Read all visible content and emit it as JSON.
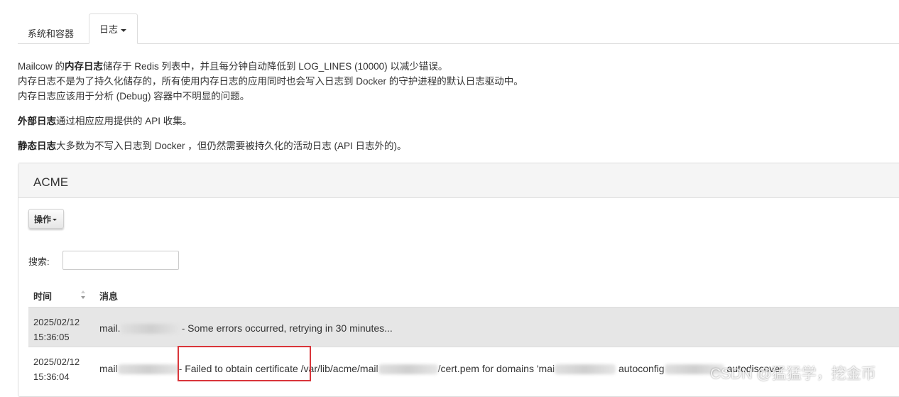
{
  "tabs": {
    "system": "系统和容器",
    "logs": "日志"
  },
  "intro": {
    "line1_pre": "Mailcow 的",
    "line1_bold": "内存日志",
    "line1_post": "储存于 Redis 列表中，并且每分钟自动降低到 LOG_LINES (10000) 以减少错误。",
    "line2": "内存日志不是为了持久化储存的，所有使用内存日志的应用同时也会写入日志到 Docker 的守护进程的默认日志驱动中。",
    "line3": "内存日志应该用于分析 (Debug) 容器中不明显的问题。",
    "line4_bold": "外部日志",
    "line4_post": "通过相应应用提供的 API 收集。",
    "line5_bold": "静态日志",
    "line5_post": "大多数为不写入日志到 Docker ，但仍然需要被持久化的活动日志 (API 日志外的)。"
  },
  "panel": {
    "title": "ACME",
    "action_button": "操作",
    "search_label": "搜索:",
    "search_value": "",
    "columns": {
      "time": "时间",
      "message": "消息"
    },
    "rows": [
      {
        "date": "2025/02/12",
        "time": "15:36:05",
        "msg_prefix": "mail.",
        "msg_text": "- Some errors occurred, retrying in 30 minutes..."
      },
      {
        "date": "2025/02/12",
        "time": "15:36:04",
        "msg_prefix": "mail",
        "msg_text": "- Failed to obtain certificate",
        "msg_path_pre": "/var/lib/acme/mail",
        "msg_path_post": "/cert.pem for domains 'mai",
        "msg_autoconfig": "autoconfig",
        "msg_autodiscover": "autodiscover"
      }
    ]
  },
  "watermark": "CSDN @猛猛学，挖金币",
  "colors": {
    "highlight": "#d9353a",
    "row_striped": "#e6e6e6",
    "panel_header": "#f5f5f5"
  }
}
